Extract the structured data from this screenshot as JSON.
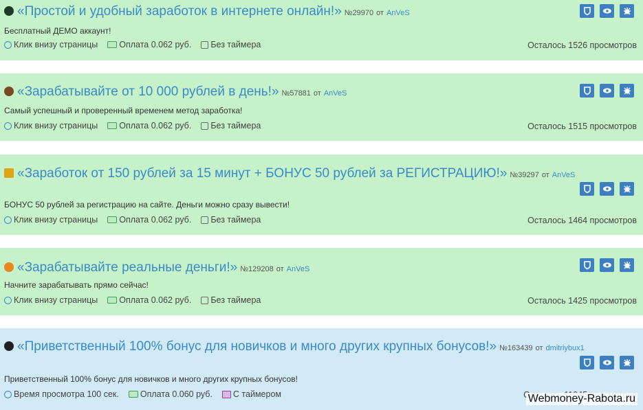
{
  "colors": {
    "card_green": "#c6f2c9",
    "card_blue": "#d2e9f6",
    "link": "#3b8ac8",
    "button": "#3d7fc1"
  },
  "tasks": [
    {
      "icon": "shield-dark-icon",
      "title": "«Простой и удобный заработок в интернете онлайн!»",
      "number": "№29970",
      "from": "от",
      "author": "AnVeS",
      "description": "Бесплатный ДЕМО аккаунт!",
      "type": "Клик внизу страницы",
      "payment": "Оплата 0.062 руб.",
      "timer": "Без таймера",
      "remaining": "Осталось 1526 просмотров"
    },
    {
      "icon": "money-bag-icon",
      "title": "«Зарабатывайте от 10 000 рублей в день!»",
      "number": "№57881",
      "from": "от",
      "author": "AnVeS",
      "description": "Самый успешный и проверенный временем метод заработка!",
      "type": "Клик внизу страницы",
      "payment": "Оплата 0.062 руб.",
      "timer": "Без таймера",
      "remaining": "Осталось 1515 просмотров"
    },
    {
      "icon": "gold-icon",
      "title": "«Заработок от 150 рублей за 15 минут + БОНУС 50 рублей за РЕГИСТРАЦИЮ!»",
      "number": "№39297",
      "from": "от",
      "author": "AnVeS",
      "description": "БОНУС 50 рублей за регистрацию на сайте. Деньги можно сразу вывести!",
      "type": "Клик внизу страницы",
      "payment": "Оплата 0.062 руб.",
      "timer": "Без таймера",
      "remaining": "Осталось 1464 просмотров"
    },
    {
      "icon": "chart-orange-icon",
      "title": "«Зарабатывайте реальные деньги!»",
      "number": "№129208",
      "from": "от",
      "author": "AnVeS",
      "description": "Начните зарабатывать прямо сейчас!",
      "type": "Клик внизу страницы",
      "payment": "Оплата 0.062 руб.",
      "timer": "Без таймера",
      "remaining": "Осталось 1425 просмотров"
    },
    {
      "icon": "rocket-dark-icon",
      "title": "«Приветственный 100% бонус для новичков и много других крупных бонусов!»",
      "number": "№163439",
      "from": "от",
      "author": "dmitriybux1",
      "description": "Приветственный 100% бонус для новичков и много других крупных бонусов!",
      "type": "Время просмотра 100 сек.",
      "payment": "Оплата 0.060 руб.",
      "timer": "С таймером",
      "remaining": "Осталось 11045 просмотров"
    }
  ],
  "buttons": {
    "block": "shield-button",
    "hide": "eye-button",
    "report": "bug-button"
  },
  "watermark": "Webmoney-Rabota.ru"
}
